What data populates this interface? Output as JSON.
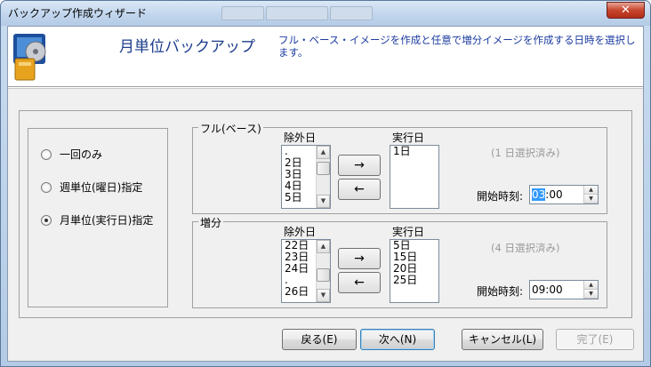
{
  "window": {
    "title": "バックアップ作成ウィザード",
    "close_label": "✕"
  },
  "header": {
    "title": "月単位バックアップ",
    "description": "フル・ベース・イメージを作成と任意で増分イメージを作成する日時を選択します。",
    "icon": "backup-wizard-icon"
  },
  "modes": [
    {
      "label": "一回のみ",
      "selected": false
    },
    {
      "label": "週単位(曜日)指定",
      "selected": false
    },
    {
      "label": "月単位(実行日)指定",
      "selected": true
    }
  ],
  "full": {
    "group_label": "フル(ベース)",
    "excluded_label": "除外日",
    "excluded_items": [
      ".",
      "2日",
      "3日",
      "4日",
      "5日"
    ],
    "executed_label": "実行日",
    "executed_items": [
      "1日"
    ],
    "add_label": "→",
    "remove_label": "←",
    "selected_note": "(1 日選択済み)",
    "time_label": "開始時刻:",
    "time_hour": "03",
    "time_rest": ":00"
  },
  "incremental": {
    "group_label": "増分",
    "excluded_label": "除外日",
    "excluded_items": [
      "22日",
      "23日",
      "24日",
      ".",
      "26日"
    ],
    "executed_label": "実行日",
    "executed_items": [
      "5日",
      "15日",
      "20日",
      "25日"
    ],
    "add_label": "→",
    "remove_label": "←",
    "selected_note": "(4 日選択済み)",
    "time_label": "開始時刻:",
    "time_value": "09:00"
  },
  "buttons": {
    "back": "戻る(E)",
    "next": "次へ(N)",
    "cancel": "キャンセル(L)",
    "finish": "完了(E)"
  }
}
